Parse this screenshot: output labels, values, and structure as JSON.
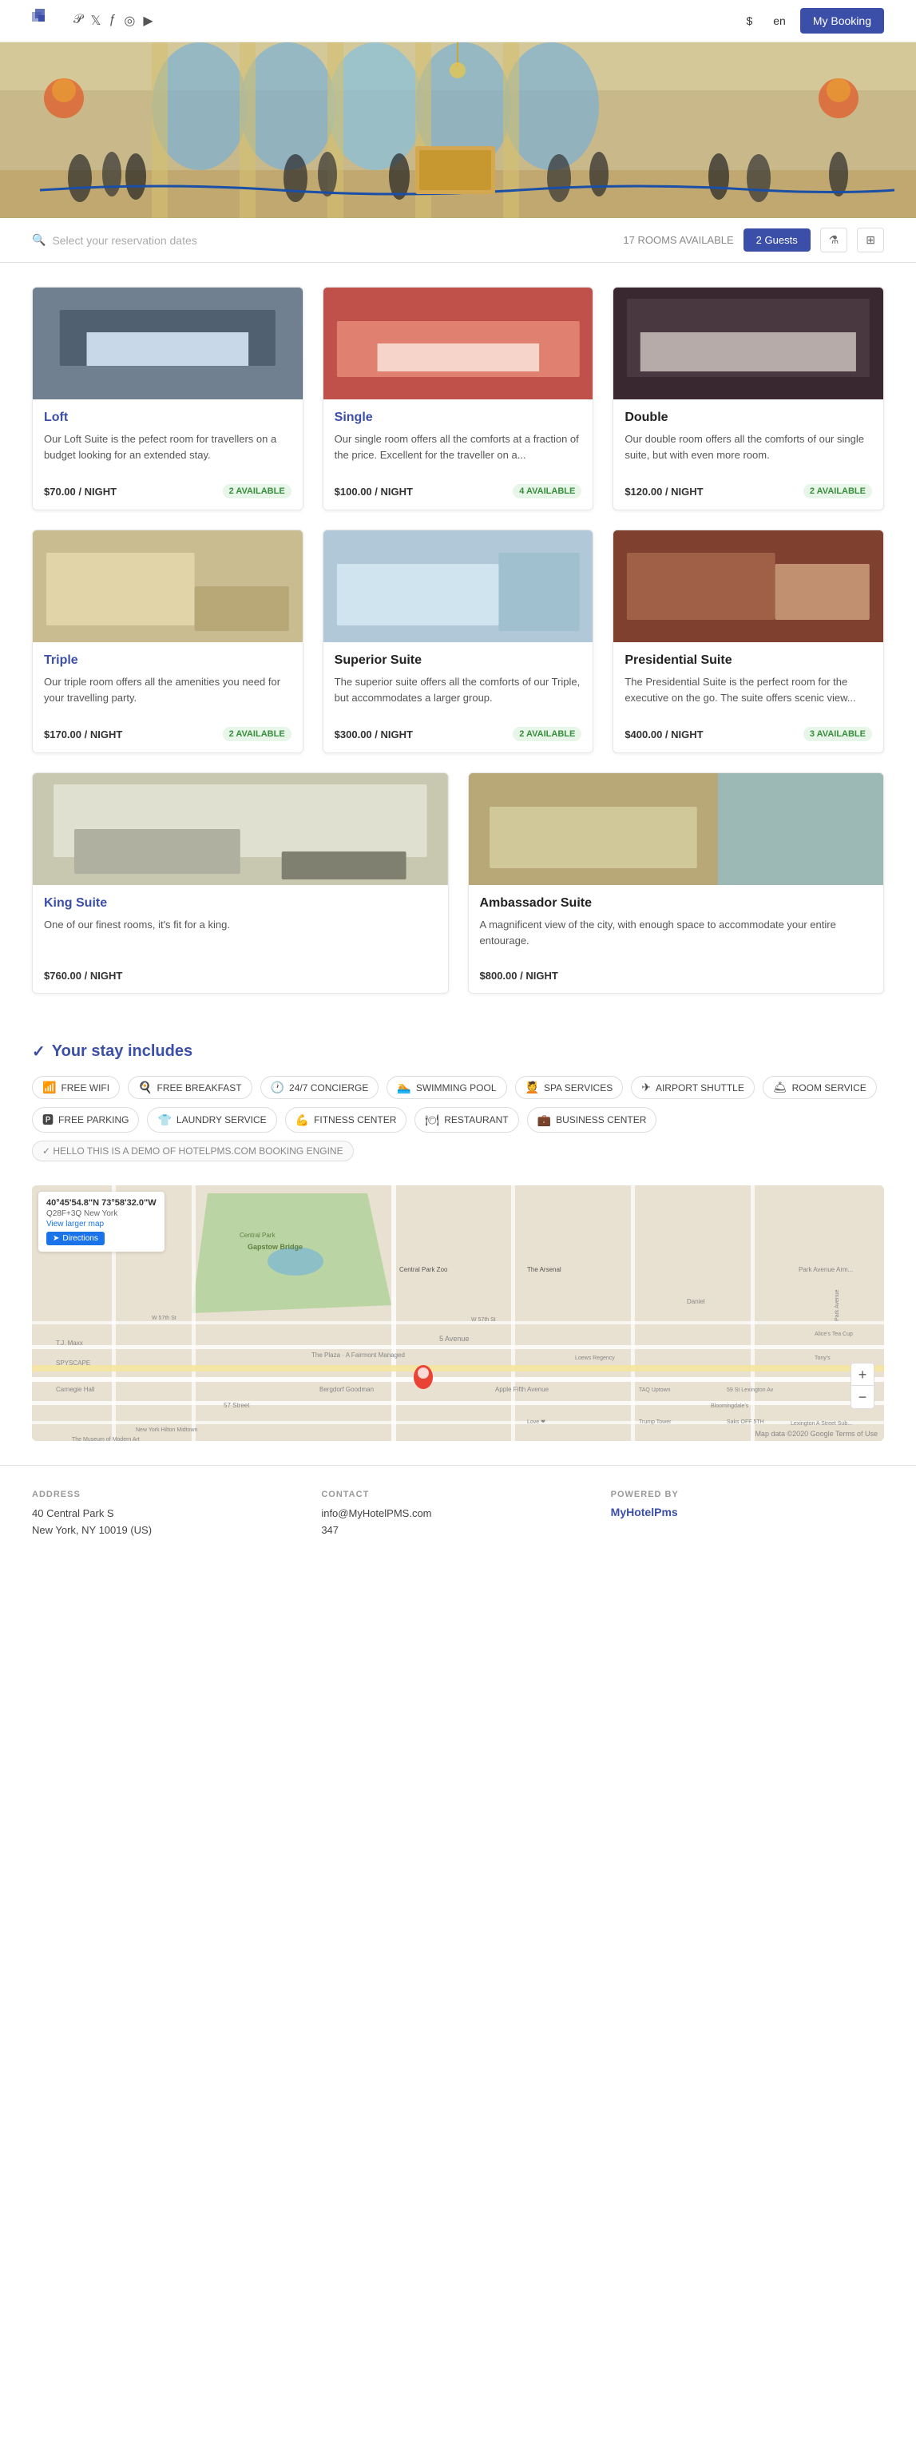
{
  "header": {
    "currency": "$",
    "language": "en",
    "my_booking_label": "My Booking",
    "social": [
      "☽",
      "𝕏",
      "ƒ",
      "📷",
      "▶"
    ]
  },
  "search": {
    "placeholder": "Select your reservation dates",
    "rooms_available": "17 ROOMS AVAILABLE",
    "guests_label": "2 Guests"
  },
  "rooms": [
    {
      "name": "Loft",
      "title_color": "blue",
      "description": "Our Loft Suite is the pefect room for travellers on a budget looking for an extended stay.",
      "price": "$70.00 / NIGHT",
      "availability": "2 AVAILABLE",
      "bg": "#c8d8e8"
    },
    {
      "name": "Single",
      "title_color": "blue",
      "description": "Our single room offers all the comforts at a fraction of the price. Excellent for the traveller on a...",
      "price": "$100.00 / NIGHT",
      "availability": "4 AVAILABLE",
      "bg": "#c0504a"
    },
    {
      "name": "Double",
      "title_color": "dark",
      "description": "Our double room offers all the comforts of our single suite, but with even more room.",
      "price": "$120.00 / NIGHT",
      "availability": "2 AVAILABLE",
      "bg": "#3a2830"
    },
    {
      "name": "Triple",
      "title_color": "blue",
      "description": "Our triple room offers all the amenities you need for your travelling party.",
      "price": "$170.00 / NIGHT",
      "availability": "2 AVAILABLE",
      "bg": "#d4c8a0"
    },
    {
      "name": "Superior Suite",
      "title_color": "dark",
      "description": "The superior suite offers all the comforts of our Triple, but accommodates a larger group.",
      "price": "$300.00 / NIGHT",
      "availability": "2 AVAILABLE",
      "bg": "#c8d8e0"
    },
    {
      "name": "Presidential Suite",
      "title_color": "dark",
      "description": "The Presidential Suite is the perfect room for the executive on the go. The suite offers scenic view...",
      "price": "$400.00 / NIGHT",
      "availability": "3 AVAILABLE",
      "bg": "#804030"
    }
  ],
  "rooms_row2": [
    {
      "name": "King Suite",
      "title_color": "blue",
      "description": "One of our finest rooms, it's fit for a king.",
      "price": "$760.00 / NIGHT",
      "availability": "",
      "bg": "#e8e8d8"
    },
    {
      "name": "Ambassador Suite",
      "title_color": "dark",
      "description": "A magnificent view of the city, with enough space to accommodate your entire entourage.",
      "price": "$800.00 / NIGHT",
      "availability": "",
      "bg": "#c8c0a0"
    }
  ],
  "stay_includes": {
    "title": "Your stay includes",
    "check_icon": "✓",
    "amenities": [
      {
        "icon": "📶",
        "label": "FREE WIFI"
      },
      {
        "icon": "🍳",
        "label": "FREE BREAKFAST"
      },
      {
        "icon": "🕐",
        "label": "24/7 CONCIERGE"
      },
      {
        "icon": "🏊",
        "label": "SWIMMING POOL"
      },
      {
        "icon": "💆",
        "label": "SPA SERVICES"
      },
      {
        "icon": "✈",
        "label": "AIRPORT SHUTTLE"
      },
      {
        "icon": "🛎",
        "label": "ROOM SERVICE"
      },
      {
        "icon": "🅿",
        "label": "FREE PARKING"
      },
      {
        "icon": "👕",
        "label": "LAUNDRY SERVICE"
      },
      {
        "icon": "💪",
        "label": "FITNESS CENTER"
      },
      {
        "icon": "🍽",
        "label": "RESTAURANT"
      },
      {
        "icon": "💼",
        "label": "BUSINESS CENTER"
      }
    ],
    "demo_label": "✓ HELLO THIS IS A DEMO OF HOTELPMS.COM BOOKING ENGINE"
  },
  "map": {
    "coords": "40°45'54.8\"N 73°58'32.0\"W",
    "plus_code": "Q28F+3Q New York",
    "view_larger": "View larger map",
    "directions_label": "Directions",
    "attribution": "Map data ©2020 Google  Terms of Use",
    "zoom_in": "+",
    "zoom_out": "−"
  },
  "footer": {
    "address_label": "ADDRESS",
    "address_line1": "40 Central Park S",
    "address_line2": "New York, NY 10019 (US)",
    "contact_label": "CONTACT",
    "contact_email": "info@MyHotelPMS.com",
    "contact_phone": "347",
    "powered_by_label": "POWERED BY",
    "powered_by_link": "MyHotelPms"
  }
}
